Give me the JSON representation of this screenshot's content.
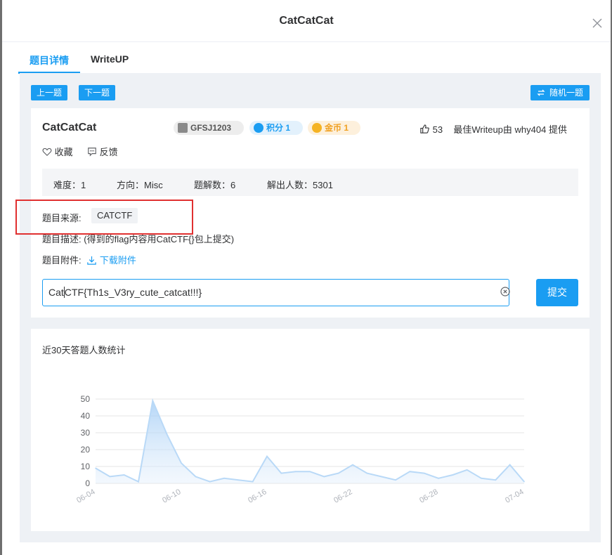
{
  "dialog": {
    "title": "CatCatCat"
  },
  "tabs": [
    {
      "label": "题目详情",
      "active": true
    },
    {
      "label": "WriteUP",
      "active": false
    }
  ],
  "toolbar": {
    "prev_label": "上一题",
    "next_label": "下一题",
    "random_label": "随机一题"
  },
  "challenge": {
    "name": "CatCatCat",
    "badges": {
      "id": "GFSJ1203",
      "score": "积分 1",
      "coins": "金币 1"
    },
    "likes": "53",
    "best_writeup": "最佳Writeup由 why404 提供",
    "favorite_label": "收藏",
    "feedback_label": "反馈",
    "stats": {
      "difficulty": "难度：1",
      "direction": "方向：Misc",
      "writeups": "题解数：6",
      "solvers": "解出人数：5301"
    },
    "source_label": "题目来源:",
    "source_value": "CATCTF",
    "description_label": "题目描述:",
    "description_value": "(得到的flag内容用CatCTF{}包上提交)",
    "attachment_label": "题目附件:",
    "download_label": "下载附件",
    "flag_value_before_caret": "Cat",
    "flag_value_after_caret": "CTF{Th1s_V3ry_cute_catcat!!!}",
    "submit_label": "提交"
  },
  "colors": {
    "accent": "#1a9df2",
    "highlight": "#e03030",
    "score_badge": "#1a9df2",
    "coin_badge": "#f0a020"
  },
  "icons": [
    "close-icon",
    "swap-icon",
    "qr-icon",
    "gem-icon",
    "coin-icon",
    "thumbs-up-icon",
    "heart-icon",
    "comment-icon",
    "download-icon",
    "clear-icon"
  ],
  "chart_data": {
    "type": "area",
    "title": "近30天答题人数统计",
    "xlabel": "",
    "ylabel": "",
    "ylim": [
      0,
      50
    ],
    "yticks": [
      0,
      10,
      20,
      30,
      40,
      50
    ],
    "x": [
      "06-04",
      "06-05",
      "06-06",
      "06-07",
      "06-08",
      "06-09",
      "06-10",
      "06-11",
      "06-12",
      "06-13",
      "06-14",
      "06-15",
      "06-16",
      "06-17",
      "06-18",
      "06-19",
      "06-20",
      "06-21",
      "06-22",
      "06-23",
      "06-24",
      "06-25",
      "06-26",
      "06-27",
      "06-28",
      "06-29",
      "06-30",
      "07-01",
      "07-02",
      "07-03",
      "07-04"
    ],
    "x_tick_labels": [
      "06-04",
      "06-10",
      "06-16",
      "06-22",
      "06-28",
      "07-04"
    ],
    "series": [
      {
        "values": [
          9,
          4,
          5,
          1,
          49,
          29,
          12,
          4,
          1,
          3,
          2,
          1,
          16,
          6,
          7,
          7,
          4,
          6,
          11,
          6,
          4,
          2,
          7,
          6,
          3,
          5,
          8,
          3,
          2,
          11,
          1
        ]
      }
    ],
    "grid": true
  }
}
